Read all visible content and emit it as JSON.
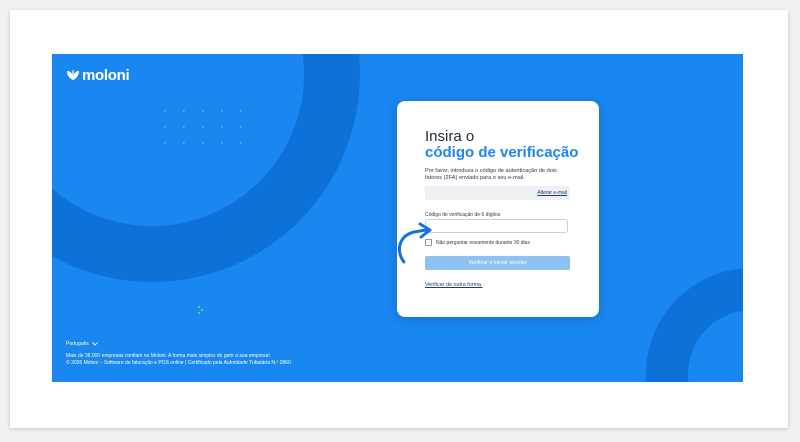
{
  "brand": {
    "name": "moloni",
    "color_primary": "#1a86f0",
    "color_deco": "#0d72d8",
    "color_dark": "#1d2b3a"
  },
  "login": {
    "title_line1": "Insira o",
    "title_line2": "código de verificação",
    "description": "Por favor, introduza o código de autenticação de dois fatores (2FA) enviado para o seu e-mail.",
    "change_email_link": "Alterar e-mail",
    "code_label": "Código de verificação de 6 dígitos",
    "code_value": "",
    "code_placeholder": "",
    "remember_label": "Não perguntar novamente durante 30 dias",
    "remember_checked": false,
    "verify_button": "Verificar e iniciar sessão",
    "other_method_link": "Verificar de outra forma."
  },
  "footer": {
    "language": "Português",
    "tagline": "Mais de 38.000 empresas confiam no Moloni. A forma mais simples de gerir a sua empresa!",
    "copyright": "© 2026 Moloni – Software de faturação e POS online | Certificado pela Autoridade Tributária N.º 2860"
  }
}
